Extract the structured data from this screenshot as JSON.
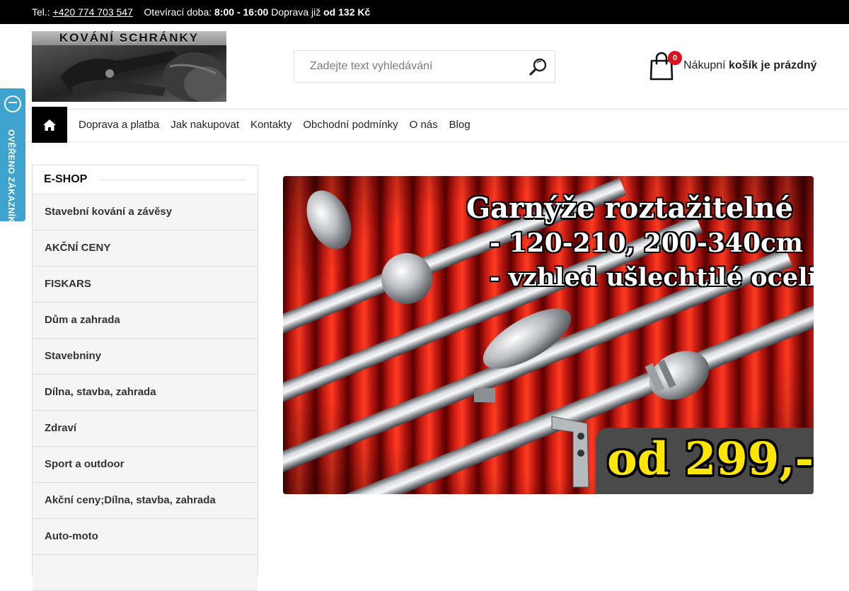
{
  "topbar": {
    "phone_label": "Tel.:",
    "phone": "+420 774 703 547",
    "hours_label": "Otevírací doba:",
    "hours": "8:00 - 16:00",
    "shipping_label": "Doprava již",
    "shipping_value": "od 132 Kč"
  },
  "logo": {
    "text": "KOVÁNÍ SCHRÁNKY"
  },
  "search": {
    "placeholder": "Zadejte text vyhledávání",
    "icon": "search-icon"
  },
  "cart": {
    "count": "0",
    "label": "Nákupní",
    "status": "košík je prázdný",
    "icon": "shopping-bag-icon"
  },
  "nav": {
    "home_icon": "home-icon",
    "items": [
      "Doprava a platba",
      "Jak nakupovat",
      "Kontakty",
      "Obchodní podmínky",
      "O nás",
      "Blog"
    ]
  },
  "verified_badge": {
    "text": "OVĚŘENO ZÁKAZNÍKY",
    "color": "#3ea3cf"
  },
  "sidebar": {
    "title": "E-SHOP",
    "items": [
      "Stavební kování a závěsy",
      "AKČNÍ CENY",
      "FISKARS",
      "Dům a zahrada",
      "Stavebniny",
      "Dílna, stavba, zahrada",
      "Zdraví",
      "Sport a outdoor",
      "Akční ceny;Dílna, stavba, zahrada",
      "Auto-moto"
    ]
  },
  "banner": {
    "title": "Garnýže roztažitelné",
    "line1": "- 120-210, 200-340cm",
    "line2": "- vzhled ušlechtilé oceli",
    "price": "od 299,-",
    "price_color": "#ffe600"
  },
  "colors": {
    "topbar": "#000000",
    "badge": "#d9131e",
    "sidebar_item_bg": "#f5f5f5"
  }
}
